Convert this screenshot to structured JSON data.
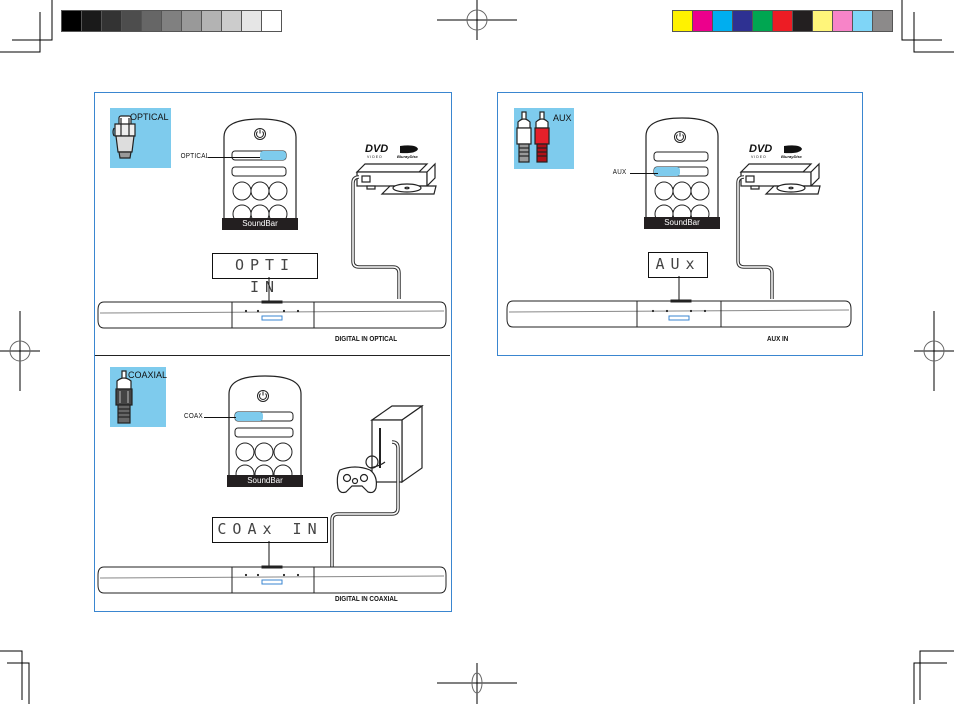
{
  "print_marks": {
    "grayscale_swatches": [
      "#000000",
      "#1a1a1a",
      "#333333",
      "#4d4d4d",
      "#666666",
      "#808080",
      "#999999",
      "#b3b3b3",
      "#cccccc",
      "#e6e6e6",
      "#ffffff"
    ],
    "color_swatches": [
      "#fff200",
      "#ec008c",
      "#00aeef",
      "#2e3192",
      "#00a651",
      "#ed1c24",
      "#231f20",
      "#fff57a",
      "#f784c8",
      "#7fd5f7",
      "#8c8a8a"
    ]
  },
  "colors": {
    "panel_border": "#3a86d0",
    "badge_fill": "#7ecbed",
    "highlight": "#7ecbed",
    "soundbar_label_bg": "#231f20"
  },
  "panels": {
    "optical": {
      "badge_label": "OPTICAL",
      "connector_icon": "optical-plug-icon",
      "remote_button_label": "OPTICAL",
      "remote_brand": "SoundBar",
      "display_text": "OPTI  IN",
      "source_device": "dvd-bluray-player",
      "logos": [
        "DVD VIDEO",
        "Blu-ray Disc"
      ],
      "caption": "DIGITAL IN OPTICAL"
    },
    "coaxial": {
      "badge_label": "COAXIAL",
      "connector_icon": "coaxial-plug-icon",
      "remote_button_label": "COAX",
      "remote_brand": "SoundBar",
      "display_text": "COAx IN",
      "source_device": "game-console",
      "caption": "DIGITAL IN COAXIAL"
    },
    "aux": {
      "badge_label": "AUX",
      "connector_icon": "rca-plugs-icon",
      "remote_button_label": "AUX",
      "remote_brand": "SoundBar",
      "display_text": "AUx",
      "source_device": "dvd-bluray-player",
      "logos": [
        "DVD VIDEO",
        "Blu-ray Disc"
      ],
      "caption": "AUX IN"
    }
  }
}
